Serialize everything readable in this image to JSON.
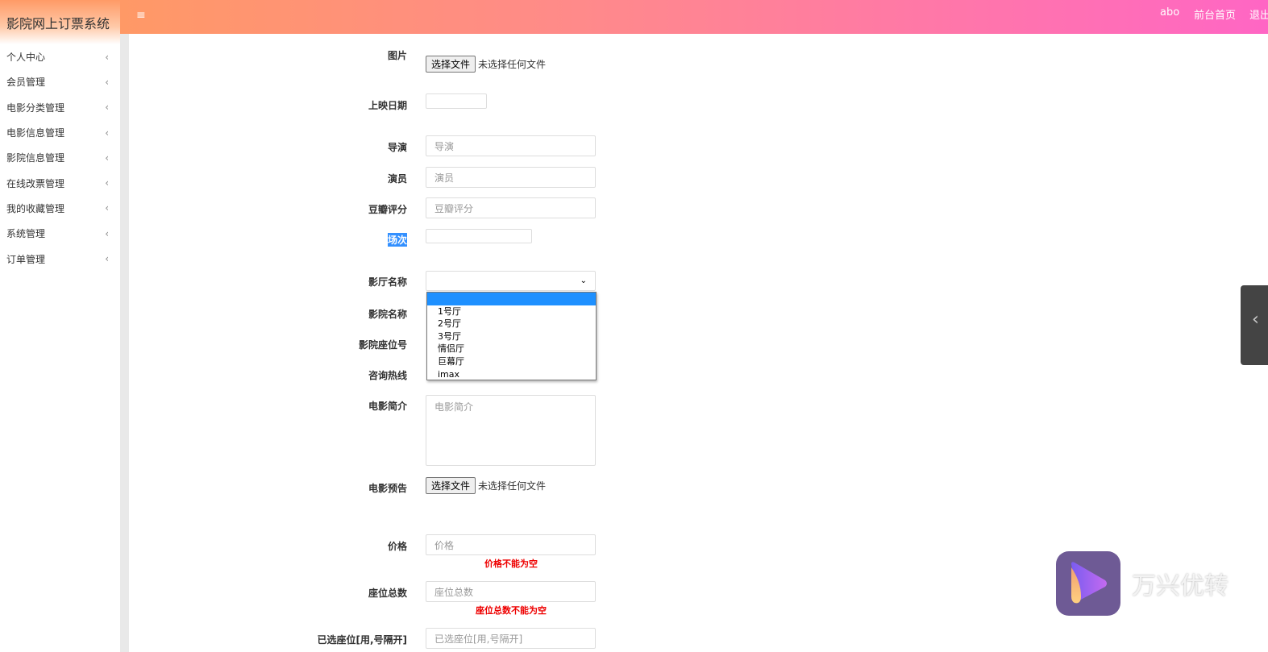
{
  "app": {
    "title": "影院网上订票系统"
  },
  "header": {
    "menu_icon": "hamburger-icon",
    "user": "abo",
    "home": "前台首页",
    "logout": "退出"
  },
  "sidebar": {
    "items": [
      {
        "label": "个人中心"
      },
      {
        "label": "会员管理"
      },
      {
        "label": "电影分类管理"
      },
      {
        "label": "电影信息管理"
      },
      {
        "label": "影院信息管理"
      },
      {
        "label": "在线改票管理"
      },
      {
        "label": "我的收藏管理"
      },
      {
        "label": "系统管理"
      },
      {
        "label": "订单管理"
      }
    ]
  },
  "form": {
    "image": {
      "label": "图片",
      "button": "选择文件",
      "status": "未选择任何文件"
    },
    "release_date": {
      "label": "上映日期",
      "value": ""
    },
    "director": {
      "label": "导演",
      "placeholder": "导演"
    },
    "actors": {
      "label": "演员",
      "placeholder": "演员"
    },
    "douban": {
      "label": "豆瓣评分",
      "placeholder": "豆瓣评分"
    },
    "session": {
      "label": "场次",
      "value": ""
    },
    "hall": {
      "label": "影厅名称",
      "value": "",
      "options": [
        "",
        "1号厅",
        "2号厅",
        "3号厅",
        "情侣厅",
        "巨幕厅",
        "imax"
      ]
    },
    "cinema": {
      "label": "影院名称"
    },
    "seat_no": {
      "label": "影院座位号"
    },
    "hotline": {
      "label": "咨询热线"
    },
    "intro": {
      "label": "电影简介",
      "placeholder": "电影简介"
    },
    "trailer": {
      "label": "电影预告",
      "button": "选择文件",
      "status": "未选择任何文件"
    },
    "price": {
      "label": "价格",
      "placeholder": "价格",
      "error": "价格不能为空"
    },
    "seat_total": {
      "label": "座位总数",
      "placeholder": "座位总数",
      "error": "座位总数不能为空"
    },
    "selected_seats": {
      "label": "已选座位[用,号隔开]",
      "placeholder": "已选座位[用,号隔开]"
    }
  },
  "colors": {
    "header_start": "#ff9966",
    "header_end": "#ff66c4",
    "error": "#ee0000",
    "selected_option": "#1e90ff"
  },
  "watermark": {
    "text": "万兴优转"
  }
}
